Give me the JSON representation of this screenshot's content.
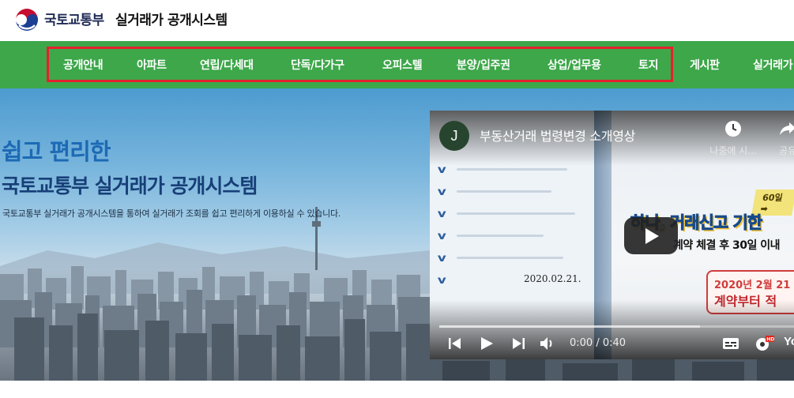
{
  "header": {
    "ministry": "국토교통부",
    "system_title": "실거래가 공개시스템"
  },
  "nav": {
    "items": [
      "공개안내",
      "아파트",
      "연립/다세대",
      "단독/다가구",
      "오피스텔",
      "분양/입주권",
      "상업/업무용",
      "토지",
      "게시판",
      "실거래가"
    ],
    "highlight_color": "#e5202e",
    "background": "#3da74a"
  },
  "hero": {
    "subtitle": "쉽고 편리한",
    "title": "국토교통부 실거래가 공개시스템",
    "description": "국토교통부 실거래가 공개시스템을 통하여 실거래가 조회를 쉽고 편리하게 이용하실 수 있습니다."
  },
  "video": {
    "channel_initial": "J",
    "title": "부동산거래 법령변경 소개영상",
    "watch_later_label": "나중에 시...",
    "share_label": "공유",
    "badge": "60일 ➡",
    "headline": "하나, 거래신고 기한 ",
    "subline": "계약 체결 후 30일 이내",
    "notice_line1": "2020년 2월 21",
    "notice_line2": "계약부터 적",
    "date": "2020.02.21.",
    "time_display": "0:00 / 0:40",
    "progress": 0,
    "brand": "Yo",
    "icons": [
      "clock-icon",
      "share-icon",
      "play-icon",
      "skip-previous-icon",
      "skip-next-icon",
      "volume-icon",
      "subtitles-icon",
      "settings-icon"
    ]
  }
}
